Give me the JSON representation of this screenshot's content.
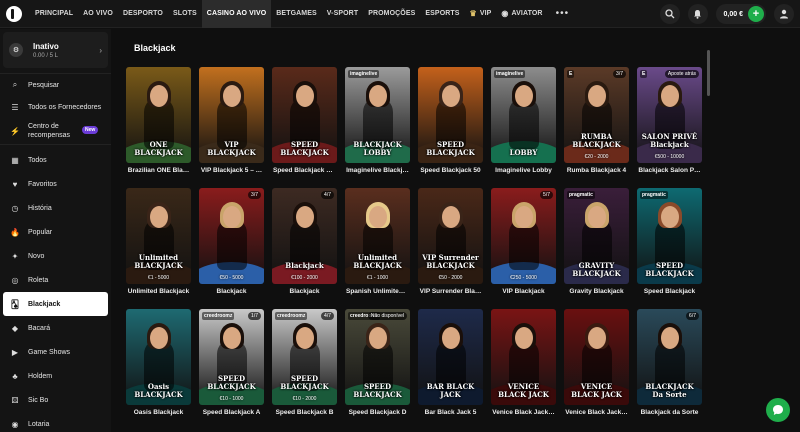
{
  "nav": {
    "items": [
      "PRINCIPAL",
      "AO VIVO",
      "DESPORTO",
      "SLOTS",
      "CASINO AO VIVO",
      "BETGAMES",
      "V-SPORT",
      "PROMOÇÕES",
      "ESPORTS",
      "VIP",
      "AVIATOR"
    ],
    "more": "•••"
  },
  "header": {
    "balance": "0,00 €",
    "plus": "+"
  },
  "profile": {
    "name": "Inativo",
    "sub": "0.00 / 5 L"
  },
  "sidebar": {
    "tools": [
      {
        "label": "Pesquisar",
        "icon": "search-icon"
      },
      {
        "label": "Todos os Fornecedores",
        "icon": "providers-icon"
      },
      {
        "label": "Centro de recompensas",
        "icon": "rewards-icon",
        "badge": "New"
      }
    ],
    "categories": [
      "Todos",
      "Favoritos",
      "História",
      "Popular",
      "Novo",
      "Roleta",
      "Blackjack",
      "Bacará",
      "Game Shows",
      "Holdem",
      "Sic Bo",
      "Lotaria"
    ],
    "active_category": "Blackjack"
  },
  "main": {
    "title": "Blackjack"
  },
  "games": [
    {
      "label": "Brazilian ONE Bla…",
      "logo": "ONE BLACKJACK",
      "bg": "#7a5a18",
      "felt": "#2d5a2a",
      "prov": "",
      "seats": "",
      "limits": "",
      "hair": "#2a1a10"
    },
    {
      "label": "VIP Blackjack 5 – …",
      "logo": "VIP BLACKJACK",
      "bg": "#c2701e",
      "felt": "#3a2a1a",
      "prov": "",
      "seats": "",
      "limits": "",
      "hair": "#2a1a10"
    },
    {
      "label": "Speed Blackjack 1…",
      "logo": "SPEED BLACKJACK",
      "bg": "#5a2a1a",
      "felt": "#6b1a1a",
      "prov": "",
      "seats": "",
      "limits": "",
      "hair": "#1a0f0a"
    },
    {
      "label": "Imaginelive Blackj…",
      "logo": "BLACKJACK LOBBY",
      "bg": "#9b9b9b",
      "felt": "#1f6b4a",
      "prov": "imaginelive",
      "seats": "",
      "limits": "",
      "hair": "#1a0f0a"
    },
    {
      "label": "Speed Blackjack 50",
      "logo": "SPEED BLACKJACK",
      "bg": "#c4611b",
      "felt": "#3a2414",
      "prov": "",
      "seats": "",
      "limits": "",
      "hair": "#3a2418"
    },
    {
      "label": "Imaginelive Lobby",
      "logo": "LOBBY",
      "bg": "#8d8d8d",
      "felt": "#15704f",
      "prov": "imaginelive",
      "seats": "",
      "limits": "",
      "hair": "#1a0f0a"
    },
    {
      "label": "Rumba Blackjack 4",
      "logo": "RUMBA BLACKJACK",
      "bg": "#5b3a27",
      "felt": "#6b2a1a",
      "prov": "E",
      "seats": "3/7",
      "limits": "€20 - 2000",
      "hair": "#2a1a10"
    },
    {
      "label": "Blackjack Salon P…",
      "logo": "SALON PRIVÉ Blackjack",
      "bg": "#6a4a8a",
      "felt": "#3a2a4a",
      "prov": "E",
      "seats": "Aposte atrás",
      "limits": "€500 - 10000",
      "hair": "#2a1a10"
    },
    {
      "label": "Unlimited Blackjack",
      "logo": "Unlimited BLACKJACK",
      "bg": "#3a2818",
      "felt": "#2a1a10",
      "prov": "",
      "seats": "",
      "limits": "€1 - 5000",
      "hair": "#3a2418"
    },
    {
      "label": "Blackjack",
      "logo": "",
      "bg": "#8a1c1c",
      "felt": "#2b5fa8",
      "prov": "",
      "seats": "3/7",
      "limits": "€50 - 5000",
      "hair": "#c9a46a"
    },
    {
      "label": "Blackjack",
      "logo": "Blackjack",
      "bg": "#3d2a22",
      "felt": "#7a1a22",
      "prov": "",
      "seats": "4/7",
      "limits": "€100 - 2000",
      "hair": "#1a0f0a"
    },
    {
      "label": "Spanish Unlimited…",
      "logo": "Unlimited BLACKJACK",
      "bg": "#5a2e1e",
      "felt": "#2a1a10",
      "prov": "",
      "seats": "",
      "limits": "€1 - 1000",
      "hair": "#e6c98a"
    },
    {
      "label": "VIP Surrender Bla…",
      "logo": "VIP Surrender BLACKJACK",
      "bg": "#4a2818",
      "felt": "#2a1a10",
      "prov": "",
      "seats": "",
      "limits": "€50 - 2000",
      "hair": "#3a2418"
    },
    {
      "label": "VIP Blackjack",
      "logo": "",
      "bg": "#8a1c1c",
      "felt": "#2b5fa8",
      "prov": "",
      "seats": "5/7",
      "limits": "€250 - 5000",
      "hair": "#c9a46a"
    },
    {
      "label": "Gravity Blackjack",
      "logo": "GRAVITY BLACKJACK",
      "bg": "#3a1e3a",
      "felt": "#2a2a4a",
      "prov": "pragmatic",
      "seats": "",
      "limits": "",
      "hair": "#c9a46a"
    },
    {
      "label": "Speed Blackjack",
      "logo": "SPEED BLACKJACK",
      "bg": "#0e6a72",
      "felt": "#0a3a4a",
      "prov": "pragmatic",
      "seats": "",
      "limits": "",
      "hair": "#8a4a2a"
    },
    {
      "label": "Oasis Blackjack",
      "logo": "Oasis BLACKJACK",
      "bg": "#1e6a72",
      "felt": "#0a3a3a",
      "prov": "",
      "seats": "",
      "limits": "",
      "hair": "#2a1a10"
    },
    {
      "label": "Speed Blackjack A",
      "logo": "SPEED BLACKJACK",
      "bg": "#c9c9c9",
      "felt": "#1a5a3a",
      "prov": "creedroomz",
      "seats": "1/7",
      "limits": "€10 - 1000",
      "hair": "#1a0f0a"
    },
    {
      "label": "Speed Blackjack B",
      "logo": "SPEED BLACKJACK",
      "bg": "#c9c9c9",
      "felt": "#1a5a3a",
      "prov": "creedroomz",
      "seats": "4/7",
      "limits": "€10 - 2000",
      "hair": "#1a0f0a"
    },
    {
      "label": "Speed Blackjack D",
      "logo": "SPEED BLACKJACK",
      "bg": "#4a4a3a",
      "felt": "#1a5a3a",
      "prov": "creedroomz",
      "seats": "Não disponível",
      "limits": "",
      "hair": "#3a2418"
    },
    {
      "label": "Bar Black Jack 5",
      "logo": "BAR BLACK JACK",
      "bg": "#1e2a4a",
      "felt": "#0e1a2e",
      "prov": "",
      "seats": "",
      "limits": "",
      "hair": "#1a0f0a"
    },
    {
      "label": "Venice Black Jack…",
      "logo": "VENICE BLACK JACK",
      "bg": "#7a1414",
      "felt": "#3a0a0a",
      "prov": "",
      "seats": "",
      "limits": "",
      "hair": "#1a0f0a"
    },
    {
      "label": "Venice Black Jack…",
      "logo": "VENICE BLACK JACK",
      "bg": "#6a1010",
      "felt": "#3a0a0a",
      "prov": "",
      "seats": "",
      "limits": "",
      "hair": "#3a1a10"
    },
    {
      "label": "Blackjack da Sorte",
      "logo": "BLACKJACK Da Sorte",
      "bg": "#2a4a5a",
      "felt": "#0e2a3a",
      "prov": "",
      "seats": "6/7",
      "limits": "",
      "hair": "#1a0f0a"
    }
  ],
  "colors": {
    "accent": "#1fae4b",
    "new_badge": "#6b3cd8",
    "active_nav": "#2c2c2c"
  }
}
